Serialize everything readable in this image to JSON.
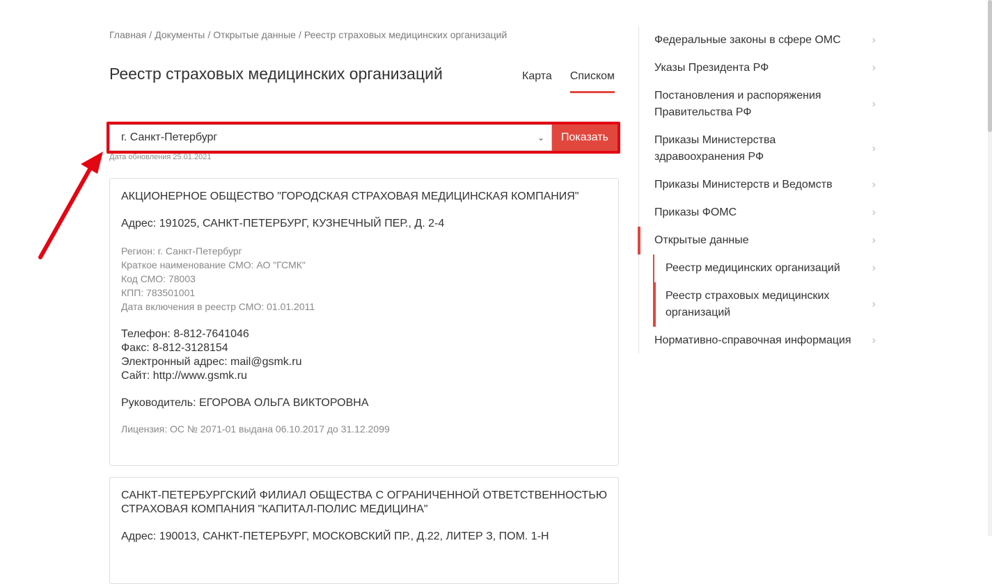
{
  "breadcrumb": {
    "items": [
      "Главная",
      "Документы",
      "Открытые данные"
    ],
    "current": "Реестр страховых медицинских организаций",
    "separator": "/"
  },
  "page_title": "Реестр страховых медицинских организаций",
  "tabs": {
    "map": "Карта",
    "list": "Списком"
  },
  "filter": {
    "region": "г. Санкт-Петербург",
    "button": "Показать"
  },
  "update_date": "Дата обновления 25.01.2021",
  "cards": [
    {
      "name": "АКЦИОНЕРНОЕ ОБЩЕСТВО \"ГОРОДСКАЯ СТРАХОВАЯ МЕДИЦИНСКАЯ КОМПАНИЯ\"",
      "address": "Адрес: 191025, САНКТ-ПЕТЕРБУРГ, КУЗНЕЧНЫЙ ПЕР., Д. 2-4",
      "region": "Регион: г. Санкт-Петербург",
      "short_name": "Краткое наименование СМО: АО \"ГСМК\"",
      "code": "Код СМО: 78003",
      "kpp": "КПП: 783501001",
      "included": "Дата включения в реестр СМО: 01.01.2011",
      "phone": "Телефон: 8-812-7641046",
      "fax": "Факс: 8-812-3128154",
      "email": "Электронный адрес: mail@gsmk.ru",
      "site": "Сайт: http://www.gsmk.ru",
      "head": "Руководитель: ЕГОРОВА ОЛЬГА ВИКТОРОВНА",
      "license": "Лицензия: ОС № 2071-01 выдана 06.10.2017 до 31.12.2099"
    },
    {
      "name": "САНКТ-ПЕТЕРБУРГСКИЙ ФИЛИАЛ ОБЩЕСТВА С ОГРАНИЧЕННОЙ ОТВЕТСТВЕННОСТЬЮ СТРАХОВАЯ КОМПАНИЯ \"КАПИТАЛ-ПОЛИС МЕДИЦИНА\"",
      "address": "Адрес: 190013, САНКТ-ПЕТЕРБУРГ, МОСКОВСКИЙ ПР., Д.22, ЛИТЕР З, ПОМ. 1-Н"
    }
  ],
  "sidebar": {
    "items": [
      "Федеральные законы в сфере ОМС",
      "Указы Президента РФ",
      "Постановления и распоряжения Правительства РФ",
      "Приказы Министерства здравоохранения РФ",
      "Приказы Министерств и Ведомств",
      "Приказы ФОМС",
      "Открытые данные"
    ],
    "subitems": [
      "Реестр медицинских организаций",
      "Реестр страховых медицинских организаций"
    ],
    "last": "Нормативно-справочная информация"
  },
  "colors": {
    "accent": "#e1473d",
    "highlight": "#e30613"
  }
}
